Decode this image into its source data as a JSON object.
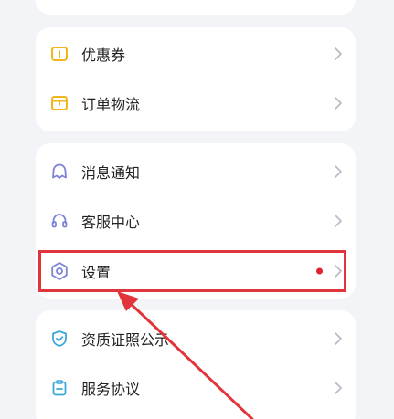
{
  "colors": {
    "background": "#f3f4f8",
    "card": "#ffffff",
    "text": "#222222",
    "chevron": "#b9bcc4",
    "icon_yellow": "#f1b51e",
    "icon_purple": "#7c83d6",
    "icon_teal": "#3aa8d8",
    "notification_dot": "#e0222f",
    "annotation_red": "#e2353b"
  },
  "group1": {
    "items": [
      {
        "label": "优惠券",
        "icon": "coupon-icon"
      },
      {
        "label": "订单物流",
        "icon": "package-icon"
      }
    ]
  },
  "group2": {
    "items": [
      {
        "label": "消息通知",
        "icon": "bell-icon"
      },
      {
        "label": "客服中心",
        "icon": "headset-icon"
      },
      {
        "label": "设置",
        "icon": "settings-hexagon-icon",
        "has_dot": true
      }
    ]
  },
  "group3": {
    "items": [
      {
        "label": "资质证照公示",
        "icon": "shield-check-icon"
      },
      {
        "label": "服务协议",
        "icon": "clipboard-icon"
      }
    ]
  }
}
